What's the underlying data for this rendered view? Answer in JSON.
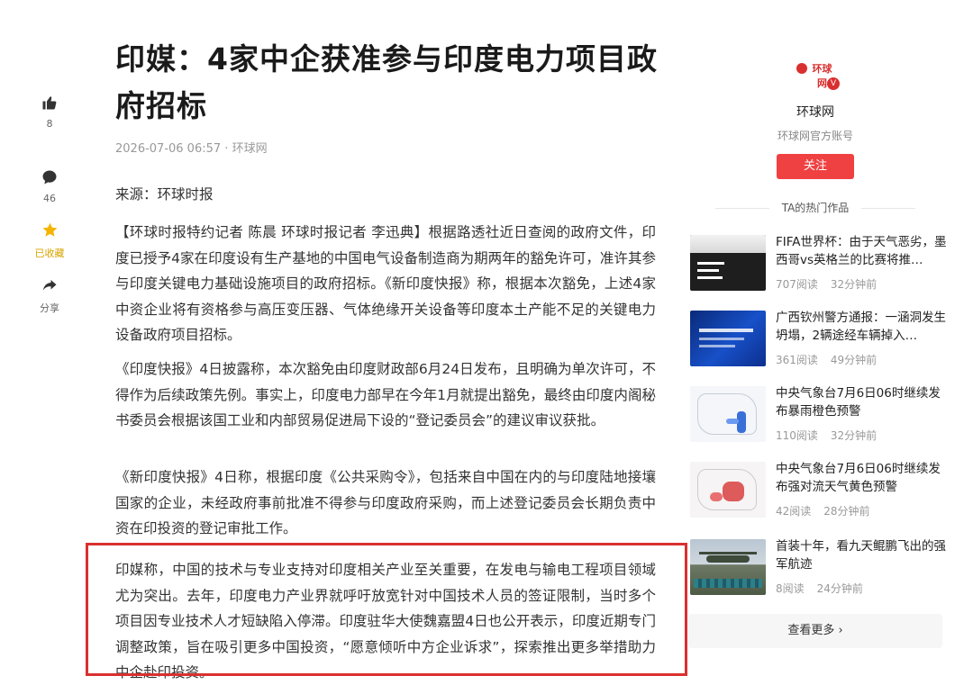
{
  "actions": {
    "like_count": "8",
    "comment_count": "46",
    "favorite_label": "已收藏",
    "share_label": "分享"
  },
  "article": {
    "title": "印媒：4家中企获准参与印度电力项目政府招标",
    "date": "2026-07-06 06:57",
    "source": "环球网",
    "paragraphs": [
      "来源：环球时报",
      "【环球时报特约记者 陈晨 环球时报记者 李迅典】根据路透社近日查阅的政府文件，印度已授予4家在印度设有生产基地的中国电气设备制造商为期两年的豁免许可，准许其参与印度关键电力基础设施项目的政府招标。《新印度快报》称，根据本次豁免，上述4家中资企业将有资格参与高压变压器、气体绝缘开关设备等印度本土产能不足的关键电力设备政府项目招标。",
      "《印度快报》4日披露称，本次豁免由印度财政部6月24日发布，且明确为单次许可，不得作为后续政策先例。事实上，印度电力部早在今年1月就提出豁免，最终由印度内阁秘书委员会根据该国工业和内部贸易促进局下设的“登记委员会”的建议审议获批。",
      "《新印度快报》4日称，根据印度《公共采购令》，包括来自中国在内的与印度陆地接壤国家的企业，未经政府事前批准不得参与印度政府采购，而上述登记委员会长期负责中资在印投资的登记审批工作。",
      "印媒称，中国的技术与专业支持对印度相关产业至关重要，在发电与输电工程项目领域尤为突出。去年，印度电力产业界就呼吁放宽针对中国技术人员的签证限制，当时多个项目因专业技术人才短缺陷入停滞。印度驻华大使魏嘉盟4日也公开表示，印度近期专门调整政策，旨在吸引更多中国投资，“愿意倾听中方企业诉求”，探索推出更多举措助力中企赴印投资。"
    ]
  },
  "account": {
    "logo_text": "环球网",
    "verified_mark": "V",
    "name": "环球网",
    "description": "环球网官方账号",
    "follow_label": "关注"
  },
  "hot": {
    "heading": "TA的热门作品",
    "items": [
      {
        "title": "FIFA世界杯：由于天气恶劣，墨西哥vs英格兰的比赛将推…",
        "reads": "707阅读",
        "time": "32分钟前",
        "thumb": "news-dark"
      },
      {
        "title": "广西钦州警方通报：一涵洞发生坍塌，2辆途经车辆掉入…",
        "reads": "361阅读",
        "time": "49分钟前",
        "thumb": "police-blue"
      },
      {
        "title": "中央气象台7月6日06时继续发布暴雨橙色预警",
        "reads": "110阅读",
        "time": "32分钟前",
        "thumb": "map-rain"
      },
      {
        "title": "中央气象台7月6日06时继续发布强对流天气黄色预警",
        "reads": "42阅读",
        "time": "28分钟前",
        "thumb": "map-storm"
      },
      {
        "title": "首装十年，看九天鲲鹏飞出的强军航迹",
        "reads": "8阅读",
        "time": "24分钟前",
        "thumb": "aircraft-photo"
      }
    ],
    "more_label": "查看更多 ›"
  },
  "colors": {
    "accent": "#f04142",
    "highlight_border": "#d9302f",
    "favorite": "#f5b400"
  }
}
